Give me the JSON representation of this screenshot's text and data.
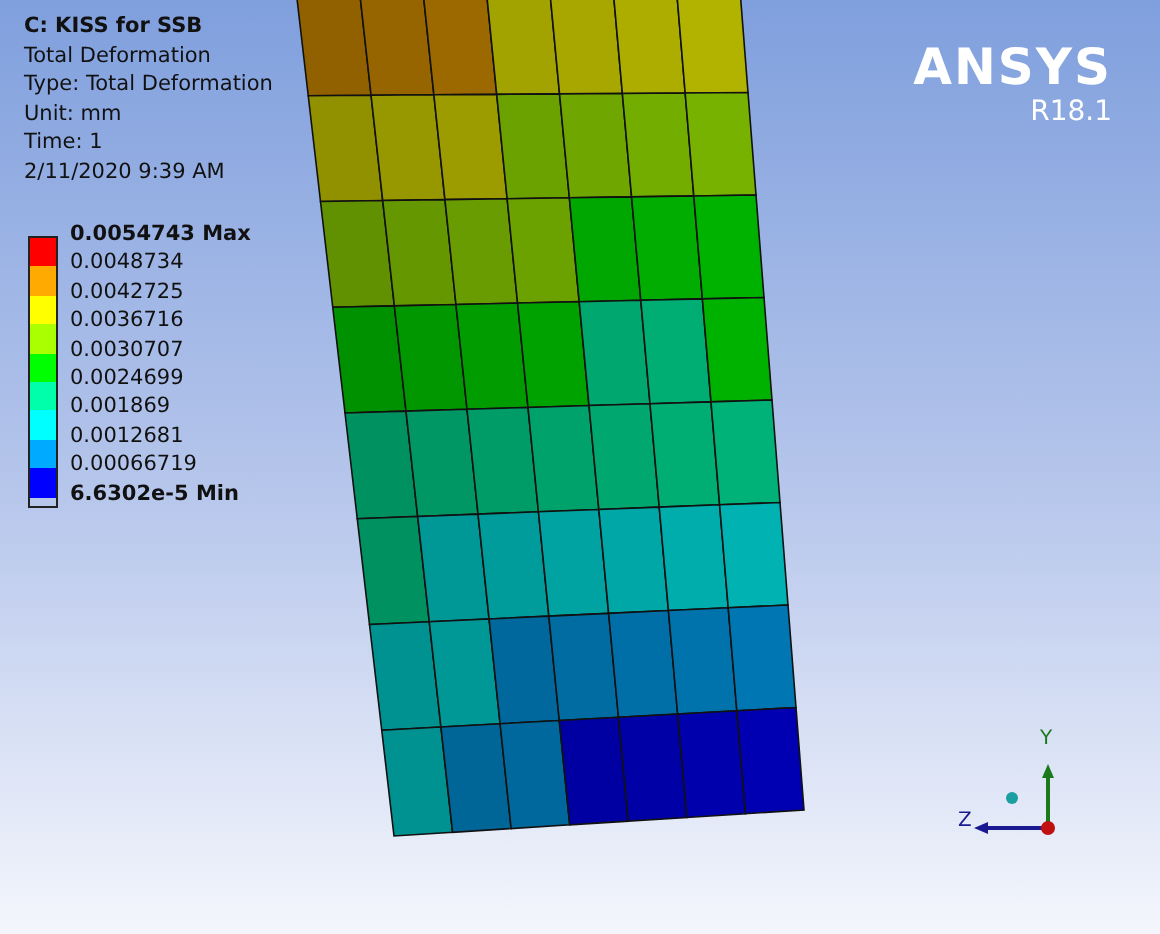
{
  "header": {
    "title": "C: KISS for SSB",
    "lines": [
      "Total Deformation",
      "Type: Total Deformation",
      "Unit: mm",
      "Time: 1",
      "2/11/2020 9:39 AM"
    ]
  },
  "legend": {
    "labels": [
      "0.0054743 Max",
      "0.0048734",
      "0.0042725",
      "0.0036716",
      "0.0030707",
      "0.0024699",
      "0.001869",
      "0.0012681",
      "0.00066719",
      "6.6302e-5 Min"
    ],
    "bands": [
      {
        "color": "#ff0000"
      },
      {
        "color": "#ffaa00"
      },
      {
        "color": "#ffff00"
      },
      {
        "color": "#aaff00"
      },
      {
        "color": "#00ff00"
      },
      {
        "color": "#00ffaa"
      },
      {
        "color": "#00ffff"
      },
      {
        "color": "#00aaff"
      },
      {
        "color": "#0000ff"
      }
    ]
  },
  "logo": {
    "name": "ANSYS",
    "version": "R18.1"
  },
  "triad": {
    "y_label": "Y",
    "z_label": "Z"
  }
}
